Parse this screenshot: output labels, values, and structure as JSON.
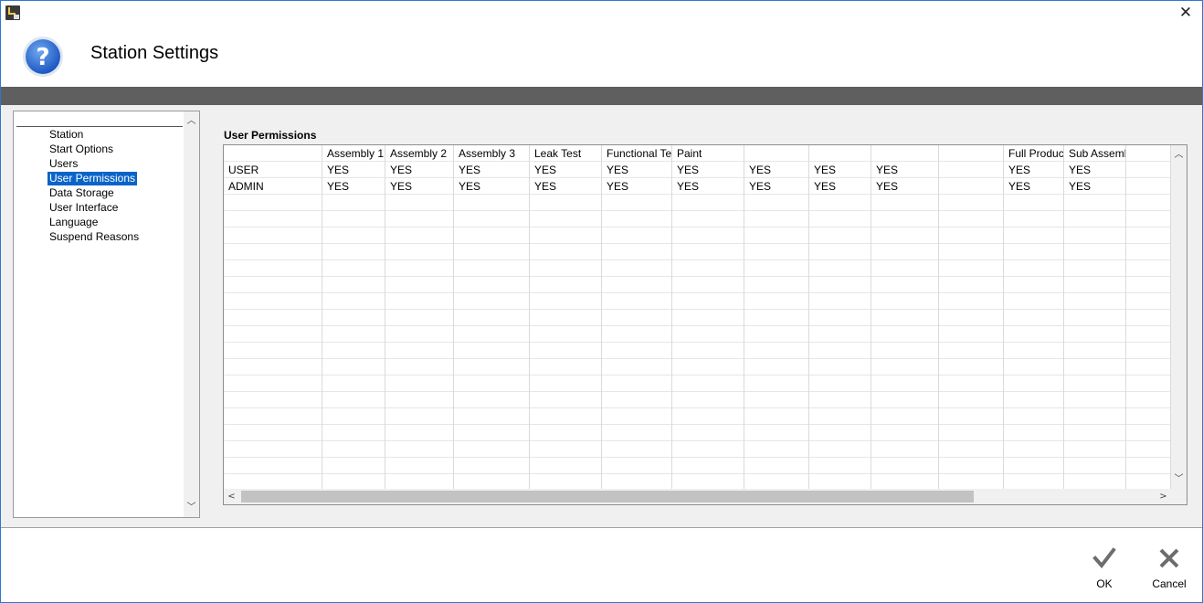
{
  "window": {
    "title": "Station Settings",
    "close_glyph": "✕"
  },
  "header": {
    "title": "Station Settings",
    "icon": "help-question-icon"
  },
  "sidebar": {
    "items": [
      {
        "label": "Station",
        "selected": false
      },
      {
        "label": "Start Options",
        "selected": false
      },
      {
        "label": "Users",
        "selected": false
      },
      {
        "label": "User Permissions",
        "selected": true
      },
      {
        "label": "Data Storage",
        "selected": false
      },
      {
        "label": "User Interface",
        "selected": false
      },
      {
        "label": "Language",
        "selected": false
      },
      {
        "label": "Suspend Reasons",
        "selected": false
      }
    ]
  },
  "permissions": {
    "title": "User Permissions",
    "columns": [
      "",
      "Assembly 1",
      "Assembly 2",
      "Assembly 3",
      "Leak Test",
      "Functional Test",
      "Paint",
      "",
      "",
      "",
      "",
      "Full Product",
      "Sub Assembly",
      ""
    ],
    "rows": [
      [
        "USER",
        "YES",
        "YES",
        "YES",
        "YES",
        "YES",
        "YES",
        "YES",
        "YES",
        "YES",
        "",
        "YES",
        "YES",
        ""
      ],
      [
        "ADMIN",
        "YES",
        "YES",
        "YES",
        "YES",
        "YES",
        "YES",
        "YES",
        "YES",
        "YES",
        "",
        "YES",
        "YES",
        ""
      ]
    ]
  },
  "footer": {
    "ok_label": "OK",
    "cancel_label": "Cancel"
  },
  "colors": {
    "accent": "#0a64c8",
    "band": "#5f5f5f",
    "help_icon": "#2a6fd6"
  }
}
